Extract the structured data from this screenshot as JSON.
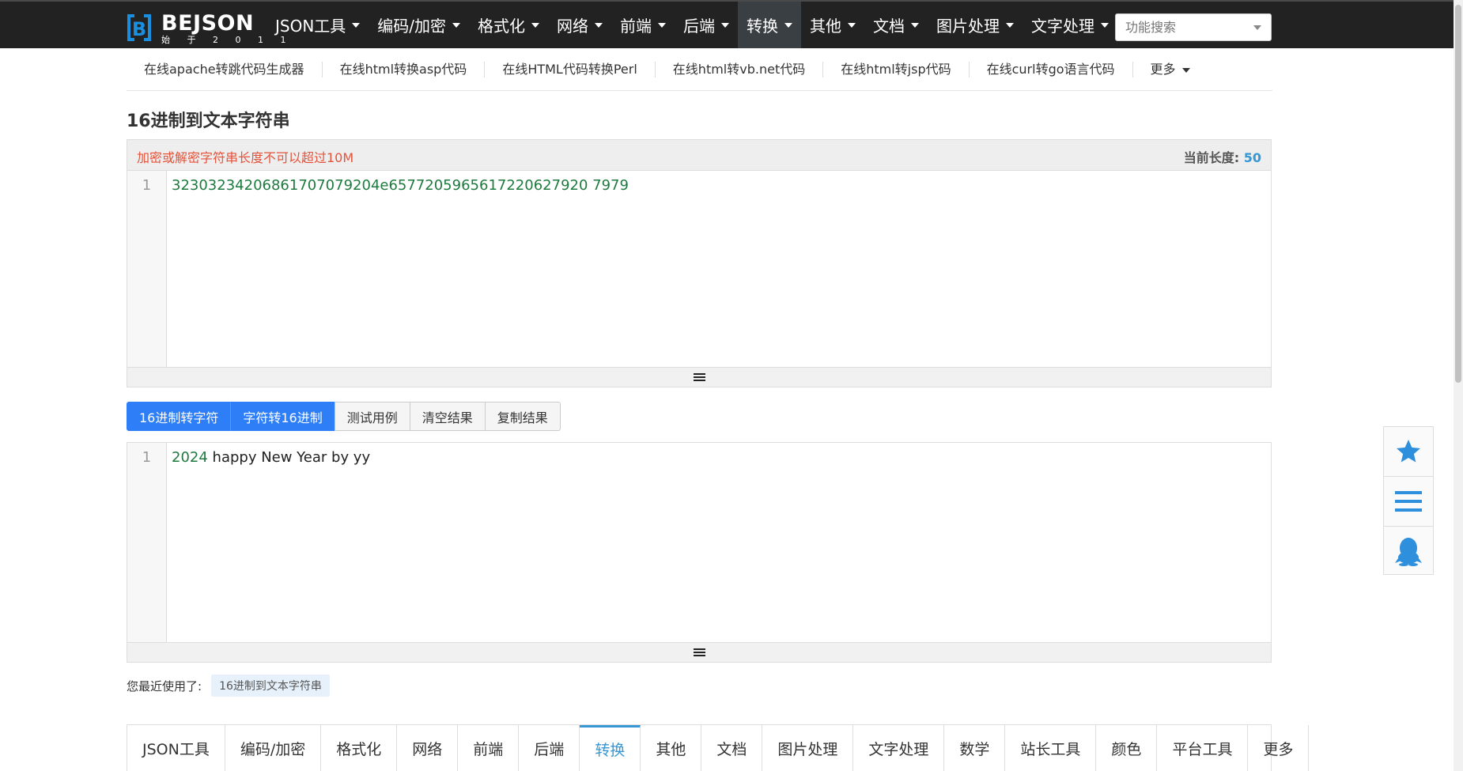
{
  "brand": {
    "name": "BEJSON",
    "tagline": "始 于 2 0 1 1",
    "mark": "B",
    "color": "#1a8fe0"
  },
  "nav": {
    "items": [
      {
        "label": "JSON工具",
        "active": false
      },
      {
        "label": "编码/加密",
        "active": false
      },
      {
        "label": "格式化",
        "active": false
      },
      {
        "label": "网络",
        "active": false
      },
      {
        "label": "前端",
        "active": false
      },
      {
        "label": "后端",
        "active": false
      },
      {
        "label": "转换",
        "active": true
      },
      {
        "label": "其他",
        "active": false
      },
      {
        "label": "文档",
        "active": false
      },
      {
        "label": "图片处理",
        "active": false
      },
      {
        "label": "文字处理",
        "active": false
      }
    ],
    "search_placeholder": "功能搜索"
  },
  "subnav": {
    "items": [
      "在线apache转跳代码生成器",
      "在线html转换asp代码",
      "在线HTML代码转换Perl",
      "在线html转vb.net代码",
      "在线html转jsp代码",
      "在线curl转go语言代码"
    ],
    "more": "更多"
  },
  "page": {
    "title": "16进制到文本字符串"
  },
  "input_panel": {
    "warning": "加密或解密字符串长度不可以超过10M",
    "length_label": "当前长度:",
    "length_value": "50",
    "line_number": "1",
    "content": "32303234206861707079204e6577205965617220627920 7979"
  },
  "buttons": {
    "hex_to_str": "16进制转字符",
    "str_to_hex": "字符转16进制",
    "test_case": "测试用例",
    "clear": "清空结果",
    "copy": "复制结果"
  },
  "output_panel": {
    "line_number": "1",
    "content_num": "2024",
    "content_text": " happy New Year by yy"
  },
  "recent": {
    "label": "您最近使用了:",
    "tag": "16进制到文本字符串"
  },
  "bottom_tabs": [
    {
      "label": "JSON工具",
      "active": false
    },
    {
      "label": "编码/加密",
      "active": false
    },
    {
      "label": "格式化",
      "active": false
    },
    {
      "label": "网络",
      "active": false
    },
    {
      "label": "前端",
      "active": false
    },
    {
      "label": "后端",
      "active": false
    },
    {
      "label": "转换",
      "active": true
    },
    {
      "label": "其他",
      "active": false
    },
    {
      "label": "文档",
      "active": false
    },
    {
      "label": "图片处理",
      "active": false
    },
    {
      "label": "文字处理",
      "active": false
    },
    {
      "label": "数学",
      "active": false
    },
    {
      "label": "站长工具",
      "active": false
    },
    {
      "label": "颜色",
      "active": false
    },
    {
      "label": "平台工具",
      "active": false
    },
    {
      "label": "更多",
      "active": false
    }
  ],
  "side_float": {
    "icons": [
      "star-icon",
      "menu-icon",
      "qq-penguin-icon"
    ],
    "color": "#2e8fdc"
  },
  "colors": {
    "topbar": "#222222",
    "accent": "#3597d3",
    "primary_button": "#2d7ef7",
    "warning": "#e4533a",
    "code_green": "#1e7a3e"
  }
}
